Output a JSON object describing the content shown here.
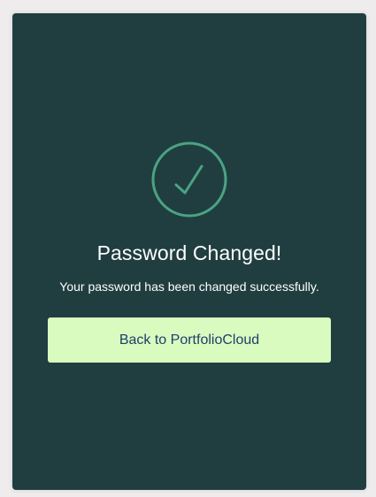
{
  "icon": {
    "name": "checkmark-circle-icon",
    "color": "#4aa383"
  },
  "card": {
    "background": "#203e40",
    "title": "Password Changed!",
    "message": "Your password has been changed successfully.",
    "button_label": "Back to PortfolioCloud",
    "button_background": "#d9fbbf",
    "button_text_color": "#1e3f6b"
  }
}
